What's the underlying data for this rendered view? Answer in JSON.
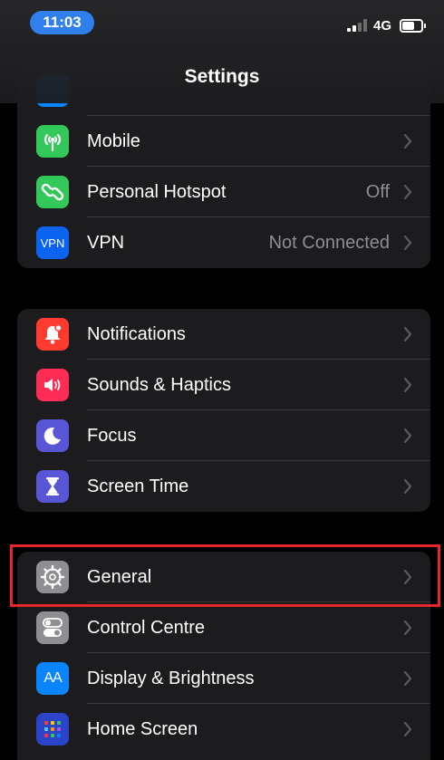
{
  "status_bar": {
    "time": "11:03",
    "network": "4G"
  },
  "header": {
    "title": "Settings"
  },
  "groups": [
    {
      "rows": [
        {
          "label": "Mobile",
          "value": "",
          "icon": "antenna-icon",
          "color": "#34c759"
        },
        {
          "label": "Personal Hotspot",
          "value": "Off",
          "icon": "hotspot-link-icon",
          "color": "#34c759"
        },
        {
          "label": "VPN",
          "value": "Not Connected",
          "icon": "vpn-icon",
          "icon_text": "VPN",
          "color": "#0a64f0"
        }
      ]
    },
    {
      "rows": [
        {
          "label": "Notifications",
          "value": "",
          "icon": "bell-icon",
          "color": "#ff3b30"
        },
        {
          "label": "Sounds & Haptics",
          "value": "",
          "icon": "speaker-icon",
          "color": "#ff2d55"
        },
        {
          "label": "Focus",
          "value": "",
          "icon": "moon-icon",
          "color": "#5856d6"
        },
        {
          "label": "Screen Time",
          "value": "",
          "icon": "hourglass-icon",
          "color": "#5856d6"
        }
      ]
    },
    {
      "rows": [
        {
          "label": "General",
          "value": "",
          "icon": "gear-icon",
          "color": "#8e8e93"
        },
        {
          "label": "Control Centre",
          "value": "",
          "icon": "toggles-icon",
          "color": "#8e8e93"
        },
        {
          "label": "Display & Brightness",
          "value": "",
          "icon": "text-size-icon",
          "icon_text": "AA",
          "color": "#0a84ff"
        },
        {
          "label": "Home Screen",
          "value": "",
          "icon": "app-grid-icon",
          "color": "#2c44c8"
        }
      ]
    }
  ],
  "highlight_color": "#e8262a"
}
